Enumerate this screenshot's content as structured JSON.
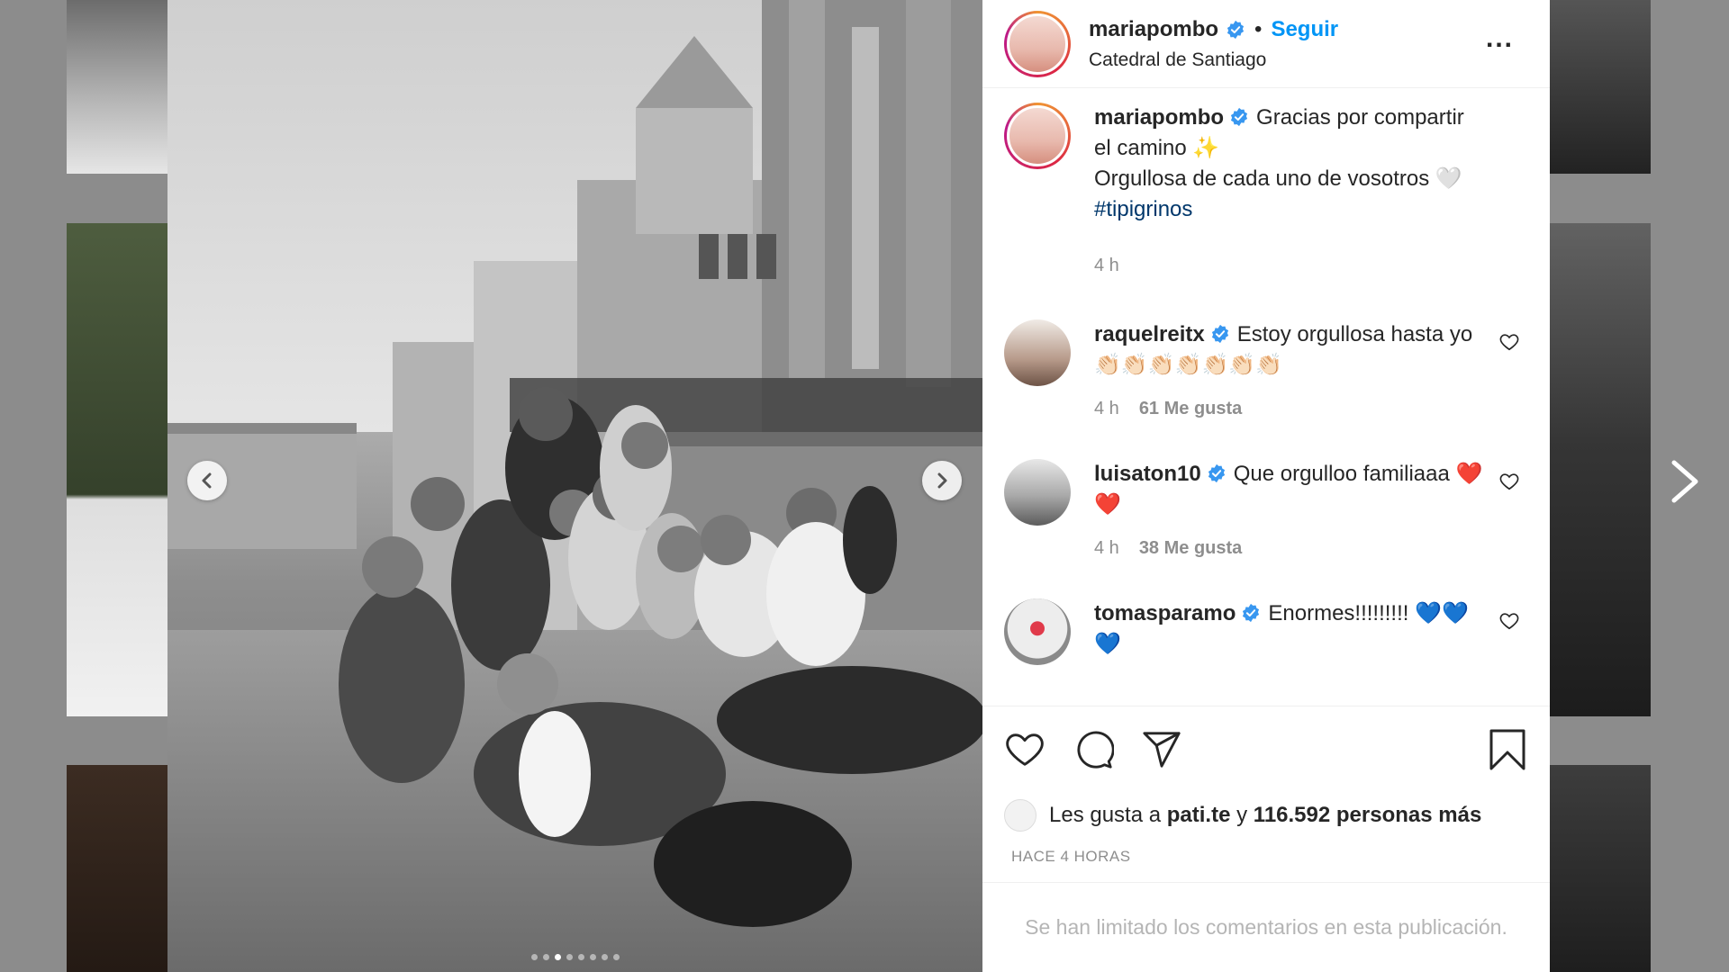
{
  "post": {
    "author": "mariapombo",
    "follow_label": "Seguir",
    "separator": "•",
    "location": "Catedral de Santiago",
    "more_label": "...",
    "caption": {
      "line1": "Gracias por compartir el camino ✨",
      "line2": "Orgullosa de cada uno de vosotros 🤍",
      "hashtag": "#tipigrinos",
      "time": "4 h"
    },
    "comments": [
      {
        "username": "raquelreitx",
        "text": "Estoy orgullosa hasta yo 👏🏻👏🏻👏🏻👏🏻👏🏻👏🏻👏🏻",
        "time": "4 h",
        "likes": "61 Me gusta"
      },
      {
        "username": "luisaton10",
        "text": "Que orgulloo familiaaa ❤️❤️",
        "time": "4 h",
        "likes": "38 Me gusta"
      },
      {
        "username": "tomasparamo",
        "text": "Enormes!!!!!!!!! 💙💙💙",
        "time": "",
        "likes": ""
      }
    ],
    "likes_row": {
      "prefix": "Les gusta a",
      "user": "pati.te",
      "middle": "y",
      "count": "116.592 personas más"
    },
    "posted": "HACE 4 HORAS",
    "comments_limited": "Se han limitado los comentarios en esta publicación.",
    "carousel": {
      "total": 8,
      "active": 3
    }
  },
  "colors": {
    "accent": "#0095f6",
    "hashtag": "#00376b",
    "verified": "#3897f0"
  }
}
